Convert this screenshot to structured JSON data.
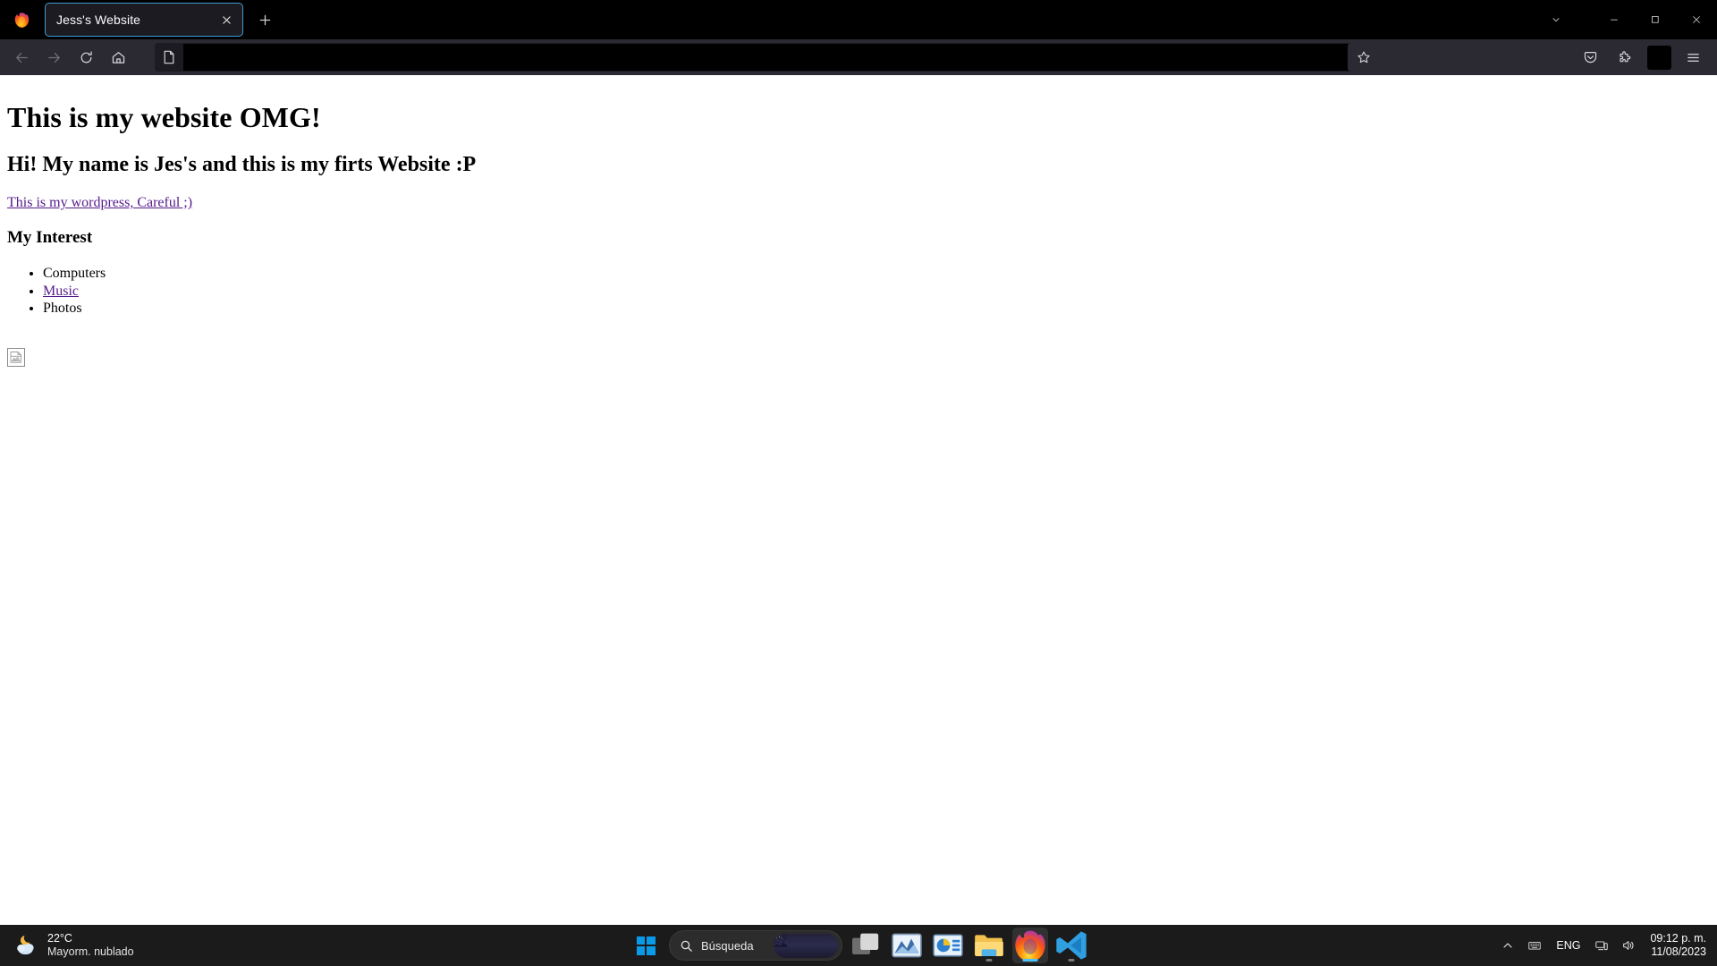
{
  "browser": {
    "logo_icon": "firefox-logo-icon",
    "tab": {
      "title": "Jess's Website",
      "close_icon": "close-icon"
    },
    "new_tab_label": "+",
    "window_controls": {
      "tab_list_icon": "chevron-down-icon",
      "minimize_icon": "minimize-icon",
      "maximize_icon": "restore-icon",
      "close_icon": "close-icon"
    },
    "toolbar": {
      "back_icon": "back-arrow-icon",
      "forward_icon": "forward-arrow-icon",
      "reload_icon": "reload-icon",
      "home_icon": "home-icon",
      "identity_icon": "page-document-icon",
      "url_value": "",
      "url_placeholder": "",
      "bookmark_icon": "star-icon",
      "pocket_icon": "pocket-icon",
      "extensions_icon": "extensions-puzzle-icon",
      "account_icon": "account-square-icon",
      "menu_icon": "hamburger-menu-icon"
    }
  },
  "page": {
    "h1": "This is my website OMG!",
    "h2": "Hi! My name is Jes's and this is my firts Website :P",
    "link_wordpress": "This is my wordpress, Careful ;)",
    "h3": "My Interest",
    "interests": [
      {
        "label": "Computers",
        "is_link": false
      },
      {
        "label": "Music",
        "is_link": true
      },
      {
        "label": "Photos",
        "is_link": false
      }
    ],
    "broken_image_icon": "broken-image-icon",
    "link_color": "#551a8b"
  },
  "taskbar": {
    "weather": {
      "icon": "moon-cloud-icon",
      "temperature": "22°C",
      "description": "Mayorm. nublado"
    },
    "start_icon": "windows-start-icon",
    "search": {
      "icon": "search-icon",
      "placeholder": "Búsqueda",
      "thumbnail_icon": "search-highlight-thumbnail"
    },
    "apps": [
      {
        "name": "task-view",
        "icon": "task-view-icon",
        "active": false,
        "running": false
      },
      {
        "name": "photos",
        "icon": "photos-chart-icon",
        "active": false,
        "running": false
      },
      {
        "name": "powerpoint",
        "icon": "powerpoint-icon",
        "active": false,
        "running": false
      },
      {
        "name": "file-explorer",
        "icon": "folder-icon",
        "active": false,
        "running": true
      },
      {
        "name": "firefox",
        "icon": "firefox-icon",
        "active": true,
        "running": true
      },
      {
        "name": "vscode",
        "icon": "vscode-icon",
        "active": false,
        "running": true
      }
    ],
    "tray": {
      "overflow_icon": "chevron-up-icon",
      "ime_icon": "keyboard-icon",
      "language": "ENG",
      "network_icon": "network-monitor-icon",
      "volume_icon": "speaker-icon",
      "time": "09:12 p. m.",
      "date": "11/08/2023"
    }
  },
  "colors": {
    "accent": "#4cc2ff",
    "tab_focus_border": "#3d9bd4",
    "chrome_bg": "#2b2a33",
    "tabstrip_bg": "#000000",
    "taskbar_bg": "#1b1b1b",
    "page_bg": "#ffffff"
  }
}
